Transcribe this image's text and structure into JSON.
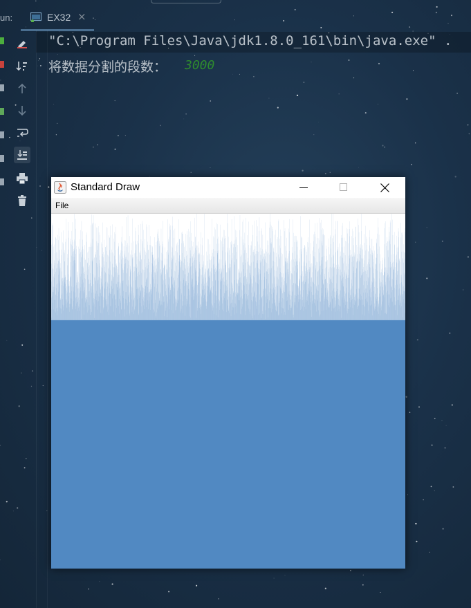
{
  "run_panel": {
    "label": "un:",
    "tab_label": "EX32",
    "tab_close": "×"
  },
  "console": {
    "command": "\"C:\\Program Files\\Java\\jdk1.8.0_161\\bin\\java.exe\" .",
    "prompt": "将数据分割的段数：",
    "input_value": "3000",
    "input_color": "#2e8b2e"
  },
  "toolbar": {
    "icons": [
      "rerun-icon",
      "scroll-to-end-icon",
      "up-icon",
      "down-icon",
      "soft-wrap-icon",
      "sort-icon",
      "print-icon",
      "trash-icon"
    ]
  },
  "draw_window": {
    "title": "Standard Draw",
    "menu": [
      "File"
    ],
    "bar_color": "#5189c2"
  },
  "chart_data": {
    "type": "bar",
    "n_bars": 3000,
    "distribution": "uniform random values",
    "bar_color": "#5189c2",
    "background": "#ffffff"
  }
}
